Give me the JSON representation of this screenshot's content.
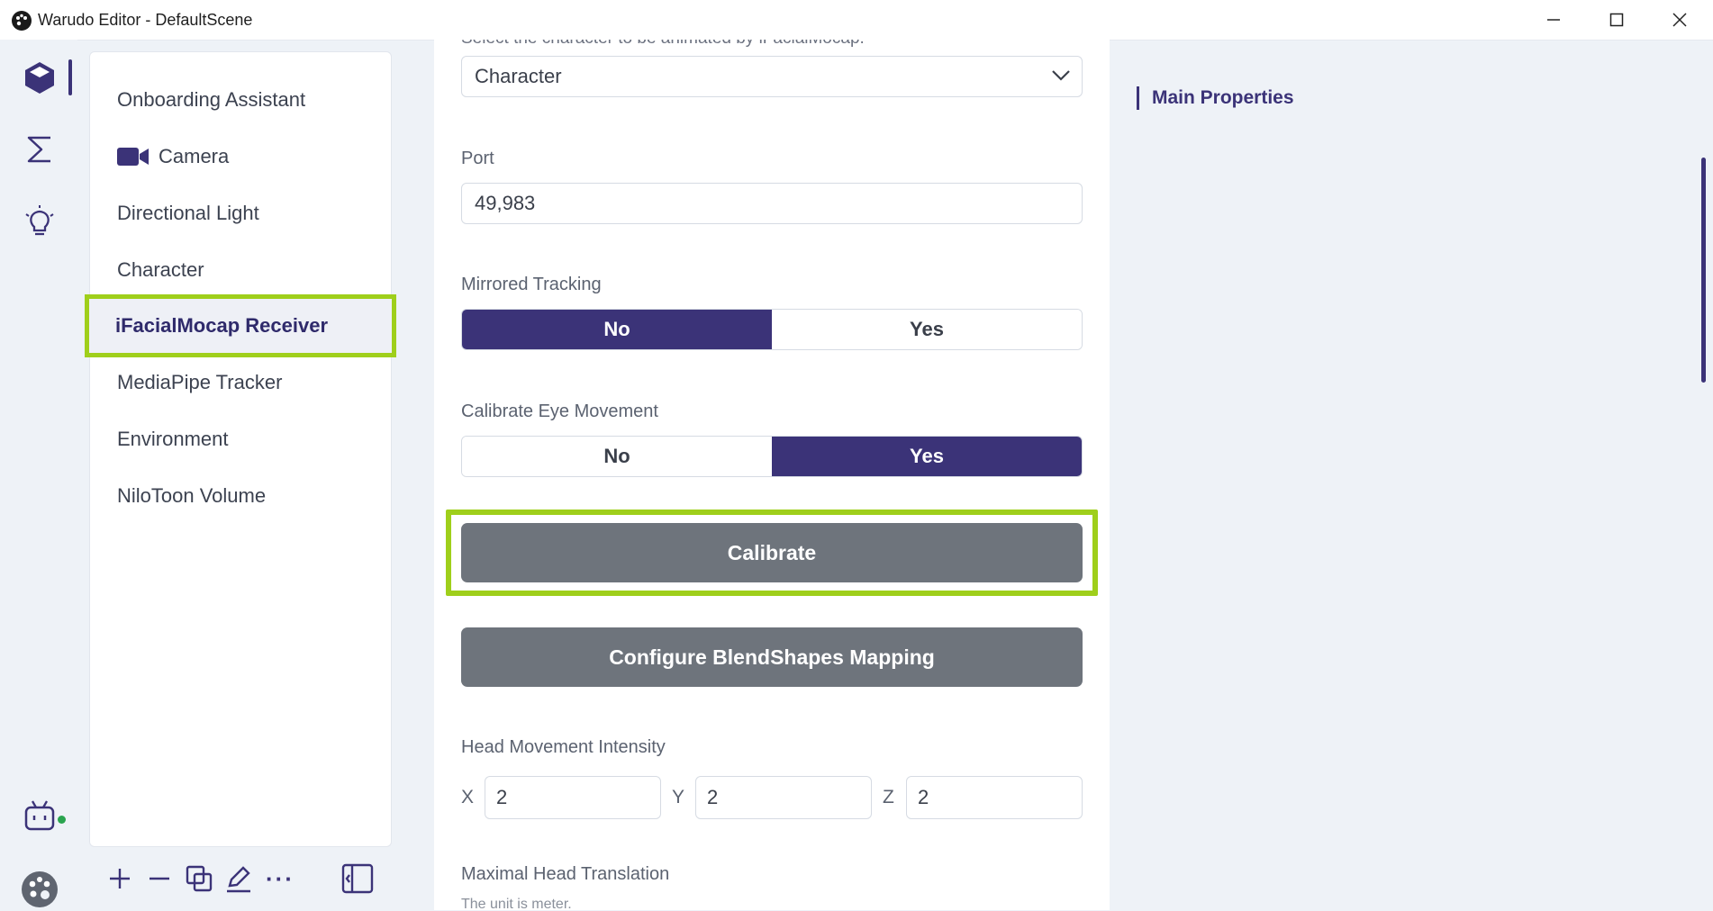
{
  "window": {
    "title": "Warudo Editor - DefaultScene",
    "controls": [
      "minimize-icon",
      "maximize-icon",
      "close-icon"
    ]
  },
  "rail": {
    "items": [
      "cube-icon",
      "sigma-icon",
      "lightbulb-icon",
      "bot-icon",
      "palette-icon"
    ],
    "active": "cube-icon"
  },
  "scene_list": {
    "items": [
      {
        "label": "Onboarding Assistant",
        "icon": null
      },
      {
        "label": "Camera",
        "icon": "camera-icon"
      },
      {
        "label": "Directional Light",
        "icon": null
      },
      {
        "label": "Character",
        "icon": null
      },
      {
        "label": "iFacialMocap Receiver",
        "icon": null,
        "selected": true
      },
      {
        "label": "MediaPipe Tracker",
        "icon": null
      },
      {
        "label": "Environment",
        "icon": null
      },
      {
        "label": "NiloToon Volume",
        "icon": null
      }
    ],
    "toolbar": [
      "plus-icon",
      "minus-icon",
      "duplicate-icon",
      "edit-icon",
      "more-icon",
      "collapse-panel-icon"
    ],
    "toolbar_more": "···"
  },
  "properties": {
    "top_cut_text": "Select the character to be animated by iFacialMocap.",
    "character_select": {
      "value": "Character"
    },
    "port": {
      "label": "Port",
      "value": "49,983"
    },
    "mirrored_tracking": {
      "label": "Mirrored Tracking",
      "options": [
        "No",
        "Yes"
      ],
      "selected": "No"
    },
    "calibrate_eye": {
      "label": "Calibrate Eye Movement",
      "options": [
        "No",
        "Yes"
      ],
      "selected": "Yes"
    },
    "calibrate_button": "Calibrate",
    "blendshapes_button": "Configure BlendShapes Mapping",
    "head_intensity": {
      "label": "Head Movement Intensity",
      "x_label": "X",
      "x": "2",
      "y_label": "Y",
      "y": "2",
      "z_label": "Z",
      "z": "2"
    },
    "max_head_translation": {
      "label": "Maximal Head Translation",
      "note": "The unit is meter."
    }
  },
  "outline": {
    "items": [
      "Main Properties"
    ]
  },
  "colors": {
    "accent": "#3b3378",
    "highlight": "#9fcf1b",
    "button_gray": "#6e747c",
    "online": "#2aa44f"
  }
}
